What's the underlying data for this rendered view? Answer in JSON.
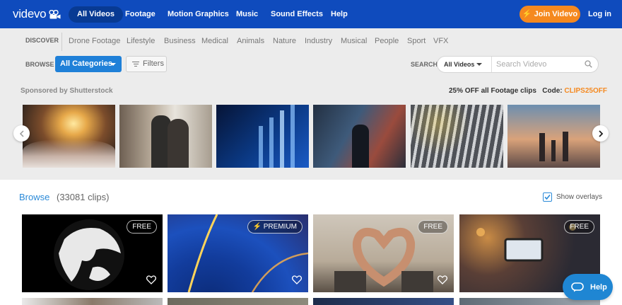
{
  "nav": {
    "logo": "videvo",
    "links": [
      "All Videos",
      "Footage",
      "Motion Graphics",
      "Music",
      "Sound Effects",
      "Help"
    ],
    "join": "Join Videvo",
    "login": "Log in"
  },
  "discover": {
    "label": "DISCOVER",
    "categories": [
      "Drone Footage",
      "Lifestyle",
      "Business",
      "Medical",
      "Animals",
      "Nature",
      "Industry",
      "Musical",
      "People",
      "Sport",
      "VFX"
    ]
  },
  "browse_bar": {
    "label": "BROWSE",
    "category_select": "All Categories",
    "filters": "Filters"
  },
  "search": {
    "label": "SEARCH",
    "scope": "All Videos",
    "placeholder": "Search Videvo"
  },
  "sponsor": {
    "text": "Sponsored by Shutterstock",
    "promo": "25% OFF all Footage clips",
    "code_label": "Code:",
    "code": "CLIPS25OFF"
  },
  "browse": {
    "title": "Browse",
    "count": "(33081 clips)",
    "overlays_label": "Show overlays",
    "overlays_checked": true
  },
  "videos": [
    {
      "badge": "FREE"
    },
    {
      "badge": "PREMIUM"
    },
    {
      "badge": "FREE"
    },
    {
      "badge": "FREE"
    }
  ],
  "help": "Help",
  "colors": {
    "nav": "#0f4bbd",
    "accent": "#f5891f",
    "link": "#2b8ad8",
    "help": "#1f86d3"
  }
}
